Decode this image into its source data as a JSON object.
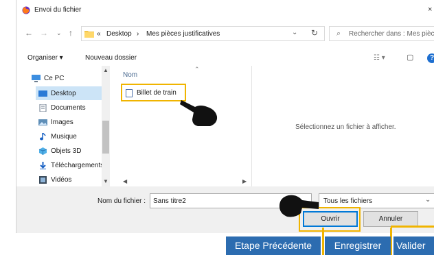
{
  "titlebar": {
    "title": "Envoi du fichier",
    "close": "×"
  },
  "address": {
    "prefix": "«",
    "crumb1": "Desktop",
    "sep": "›",
    "crumb2": "Mes pièces justificatives",
    "dropdown": "⌄",
    "refresh": "↻"
  },
  "search": {
    "icon": "⌕",
    "placeholder": "Rechercher dans : Mes pièce..."
  },
  "toolbar": {
    "organize": "Organiser ▾",
    "new_folder": "Nouveau dossier",
    "view_icon": "☷ ▾",
    "pane_icon": "▢",
    "help": "?"
  },
  "nav": {
    "items": [
      {
        "label": "Ce PC",
        "icon": "pc-icon"
      },
      {
        "label": "Desktop",
        "icon": "desktop-icon"
      },
      {
        "label": "Documents",
        "icon": "documents-icon"
      },
      {
        "label": "Images",
        "icon": "images-icon"
      },
      {
        "label": "Musique",
        "icon": "music-icon"
      },
      {
        "label": "Objets 3D",
        "icon": "objects3d-icon"
      },
      {
        "label": "Téléchargements",
        "icon": "downloads-icon"
      },
      {
        "label": "Vidéos",
        "icon": "videos-icon"
      }
    ]
  },
  "files": {
    "column_name": "Nom",
    "items": [
      {
        "label": "Billet de train"
      }
    ]
  },
  "preview": {
    "message": "Sélectionnez un fichier à afficher."
  },
  "bottom": {
    "filename_label": "Nom du fichier :",
    "filename_value": "Sans titre2",
    "filter": "Tous les fichiers",
    "open": "Ouvrir",
    "cancel": "Annuler"
  },
  "web_buttons": {
    "previous": "Etape Précédente",
    "save": "Enregistrer",
    "validate": "Valider"
  },
  "colors": {
    "highlight": "#f0b400",
    "web_button": "#2c6cb0",
    "selected": "#cce4f7",
    "focus": "#0078d7"
  }
}
